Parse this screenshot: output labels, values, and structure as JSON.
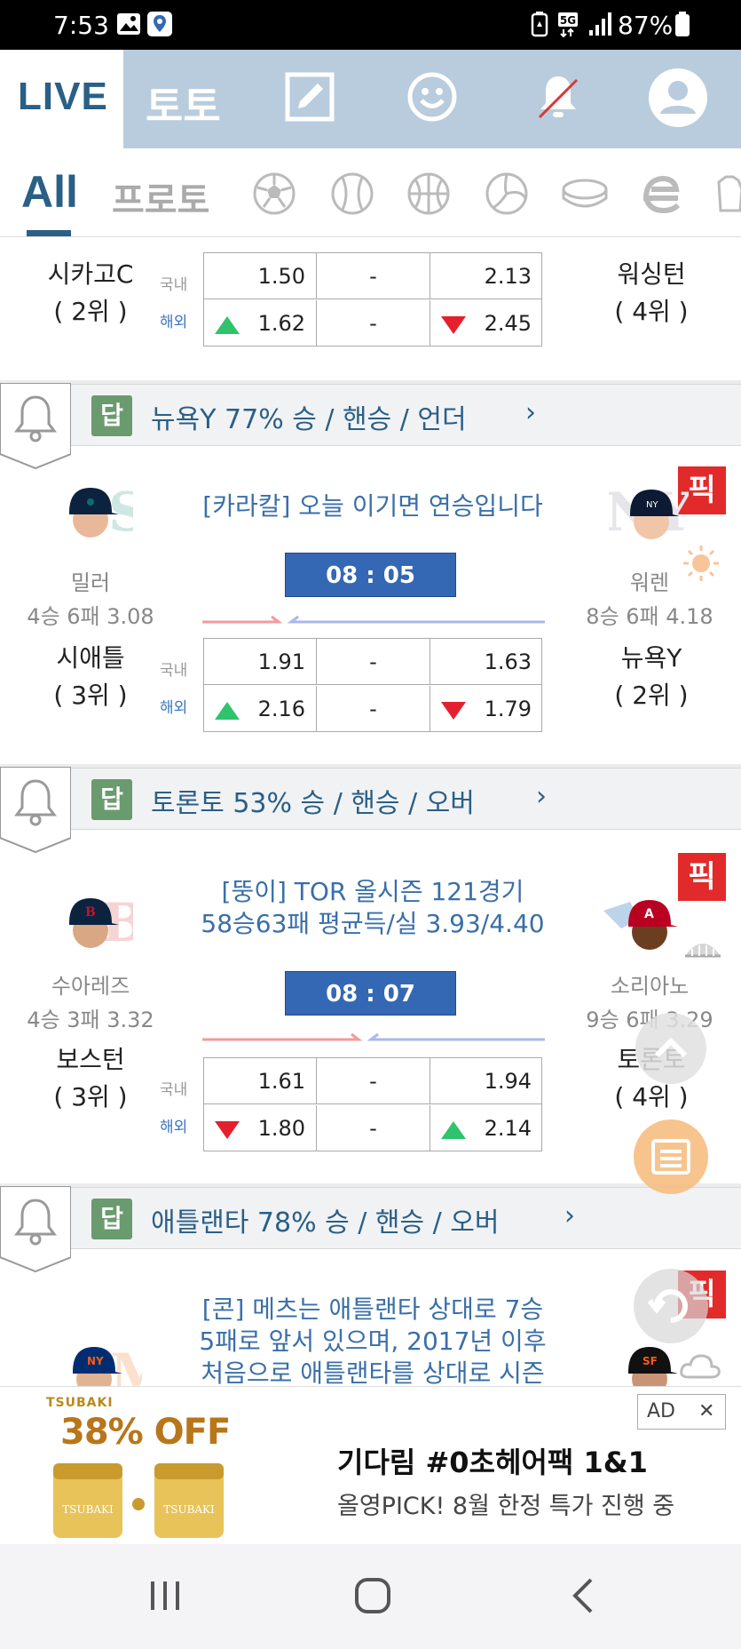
{
  "status_bar": {
    "time": "7:53",
    "battery": "87%",
    "network": "5G"
  },
  "top_nav": {
    "live_label": "LIVE",
    "toto_label": "토토"
  },
  "sports_tabs": {
    "all_label": "All",
    "proto_label": "프로토"
  },
  "games": [
    {
      "home_team": "시카고C",
      "home_rank": "( 2위 )",
      "away_team": "워싱턴",
      "away_rank": "( 4위 )",
      "domestic_label": "국내",
      "overseas_label": "해외",
      "dom_home": "1.50",
      "dom_draw": "-",
      "dom_away": "2.13",
      "ovs_home": "1.62",
      "ovs_draw": "-",
      "ovs_away": "2.45"
    },
    {
      "pick_badge": "답",
      "pick_text": "뉴욕Y 77% 승 / 핸승 / 언더",
      "comment": "[카라칼] 오늘 이기면 연승입니다",
      "time": "08 : 05",
      "home_pitcher": "밀러",
      "home_record": "4승 6패 3.08",
      "away_pitcher": "워렌",
      "away_record": "8승 6패 4.18",
      "home_team": "시애틀",
      "home_rank": "( 3위 )",
      "away_team": "뉴욕Y",
      "away_rank": "( 2위 )",
      "domestic_label": "국내",
      "overseas_label": "해외",
      "dom_home": "1.91",
      "dom_draw": "-",
      "dom_away": "1.63",
      "ovs_home": "2.16",
      "ovs_draw": "-",
      "ovs_away": "1.79",
      "pick_tag": "픽"
    },
    {
      "pick_badge": "답",
      "pick_text": "토론토 53% 승 / 핸승 / 오버",
      "comment_line1": "[뚱이] TOR 올시즌 121경기",
      "comment_line2": "58승63패 평균득/실 3.93/4.40",
      "time": "08 : 07",
      "home_pitcher": "수아레즈",
      "home_record": "4승 3패 3.32",
      "away_pitcher": "소리아노",
      "away_record": "9승 6패 3.29",
      "home_team": "보스턴",
      "home_rank": "( 3위 )",
      "away_team": "토론토",
      "away_rank": "( 4위 )",
      "domestic_label": "국내",
      "overseas_label": "해외",
      "dom_home": "1.61",
      "dom_draw": "-",
      "dom_away": "1.94",
      "ovs_home": "1.80",
      "ovs_draw": "-",
      "ovs_away": "2.14",
      "pick_tag": "픽"
    },
    {
      "pick_badge": "답",
      "pick_text": "애틀랜타 78% 승 / 핸승 / 오버",
      "comment_line1": "[콘] 메츠는 애틀랜타 상대로 7승",
      "comment_line2": "5패로 앞서 있으며, 2017년 이후",
      "comment_line3": "처음으로 애틀랜타를 상대로 시즌",
      "pick_tag": "픽"
    }
  ],
  "ad": {
    "brand": "TSUBAKI",
    "discount": "38% OFF",
    "title": "기다림 #0초헤어팩 1&1",
    "subtitle": "올영PICK! 8월 한정 특가 진행 중",
    "badge": "AD",
    "close": "✕"
  },
  "colors": {
    "primary": "#2a5f86",
    "nav_bg": "#b8ccdd",
    "time_box": "#3468b4",
    "up": "#2fc46b",
    "down": "#e5202e",
    "pick": "#e22a2a"
  }
}
